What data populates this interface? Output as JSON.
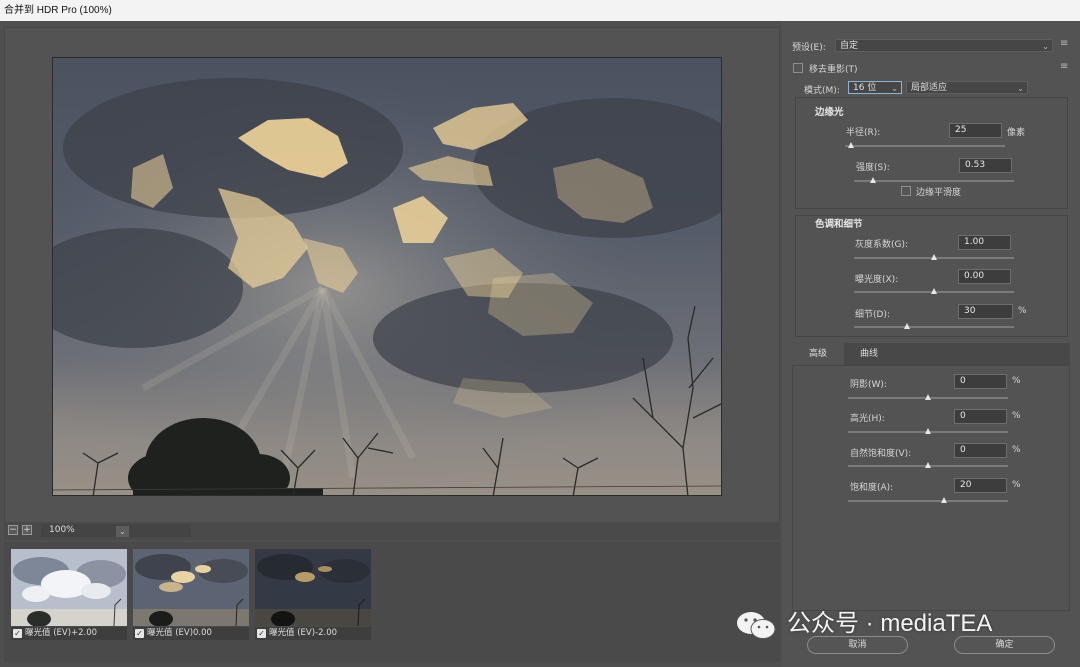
{
  "window": {
    "title": "合并到 HDR Pro (100%)"
  },
  "zoom": {
    "out_icon": "−",
    "in_icon": "+",
    "level": "100%",
    "dropdown_icon": "⌄"
  },
  "thumbnails": [
    {
      "label": "曝光值 (EV)+2.00",
      "checked": true
    },
    {
      "label": "曝光值 (EV)0.00",
      "checked": true
    },
    {
      "label": "曝光值 (EV)-2.00",
      "checked": true
    }
  ],
  "preset": {
    "label": "预设(E):",
    "value": "自定",
    "menu_icon": "≡"
  },
  "remove_ghost": {
    "label": "移去重影(T)",
    "checked": false
  },
  "mode": {
    "label": "模式(M):",
    "bit_depth": "16 位",
    "method": "局部适应"
  },
  "edge_glow": {
    "title": "边缘光",
    "radius": {
      "label": "半径(R):",
      "value": "25",
      "unit": "像素",
      "level": 0.04
    },
    "strength": {
      "label": "强度(S):",
      "value": "0.53",
      "level": 0.12
    },
    "smooth_edges": {
      "label": "边缘平滑度",
      "checked": false
    }
  },
  "tone_detail": {
    "title": "色调和细节",
    "gamma": {
      "label": "灰度系数(G):",
      "value": "1.00",
      "level": 0.5
    },
    "exposure": {
      "label": "曝光度(X):",
      "value": "0.00",
      "level": 0.5
    },
    "detail": {
      "label": "细节(D):",
      "value": "30",
      "unit": "%",
      "level": 0.33
    }
  },
  "tabs": {
    "advanced": "高级",
    "curve": "曲线"
  },
  "advanced": {
    "shadow": {
      "label": "阴影(W):",
      "value": "0",
      "unit": "%",
      "level": 0.5
    },
    "highlight": {
      "label": "高光(H):",
      "value": "0",
      "unit": "%",
      "level": 0.5
    },
    "vibrance": {
      "label": "自然饱和度(V):",
      "value": "0",
      "unit": "%",
      "level": 0.5
    },
    "saturation": {
      "label": "饱和度(A):",
      "value": "20",
      "unit": "%",
      "level": 0.6
    }
  },
  "buttons": {
    "cancel": "取消",
    "ok": "确定"
  },
  "watermark": {
    "text": "公众号 · mediaTEA"
  },
  "colors": {
    "panel": "#535353",
    "title_bar": "#f3f3f3",
    "highlight_sky": "#f0d49a"
  }
}
